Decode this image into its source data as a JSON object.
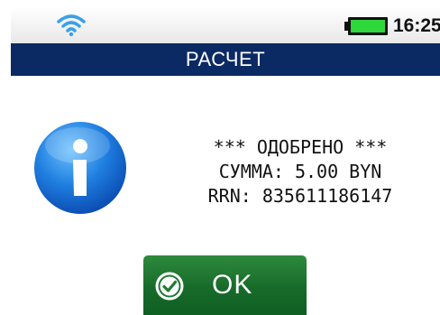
{
  "status_bar": {
    "time": "16:25",
    "wifi_icon": "wifi-icon",
    "battery_icon": "battery-icon",
    "battery_level": 1.0,
    "colors": {
      "wifi": "#3aa0e8",
      "battery": "#2fd83a"
    }
  },
  "title_bar": {
    "title": "РАСЧЕТ",
    "color": "#0b2a63"
  },
  "message": {
    "status_line": "*** ОДОБРЕНО ***",
    "amount_line": "СУММА: 5.00 BYN",
    "rrn_line": "RRN: 835611186147",
    "icon": "info-icon"
  },
  "ok_button": {
    "label": "OK",
    "icon": "check-circle-icon",
    "color": "#176b2a"
  }
}
